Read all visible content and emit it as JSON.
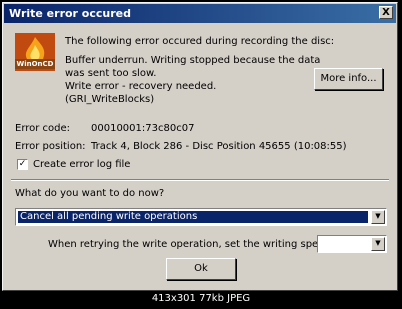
{
  "window": {
    "title": "Write error occured",
    "close_label": "X"
  },
  "app_logo": {
    "text": "WinOnCD"
  },
  "message": {
    "intro": "The following error occured during recording the disc:",
    "line1": "Buffer underrun. Writing stopped because the data",
    "line2": "was sent too slow.",
    "line3": "Write error - recovery needed.",
    "line4": "(GRI_WriteBlocks)"
  },
  "more_info_button": "More info...",
  "error_code": {
    "label": "Error code:",
    "value": "00010001:73c80c07"
  },
  "error_position": {
    "label": "Error position:",
    "value": "Track 4, Block 286 - Disc Position 45655  (10:08:55)"
  },
  "create_log": {
    "label": "Create error log file",
    "checked": true,
    "check_mark": "✓"
  },
  "action": {
    "question": "What do you want to do now?",
    "selected": "Cancel all pending write operations"
  },
  "speed": {
    "label": "When retrying the write operation, set the writing speed to",
    "value": ""
  },
  "ok_button": "Ok",
  "image_footer": "413x301  77kb  JPEG",
  "colors": {
    "titlebar_start": "#0a246a",
    "titlebar_end": "#3a6ea5",
    "dialog_bg": "#d4d0c8",
    "selection": "#0a246a"
  }
}
